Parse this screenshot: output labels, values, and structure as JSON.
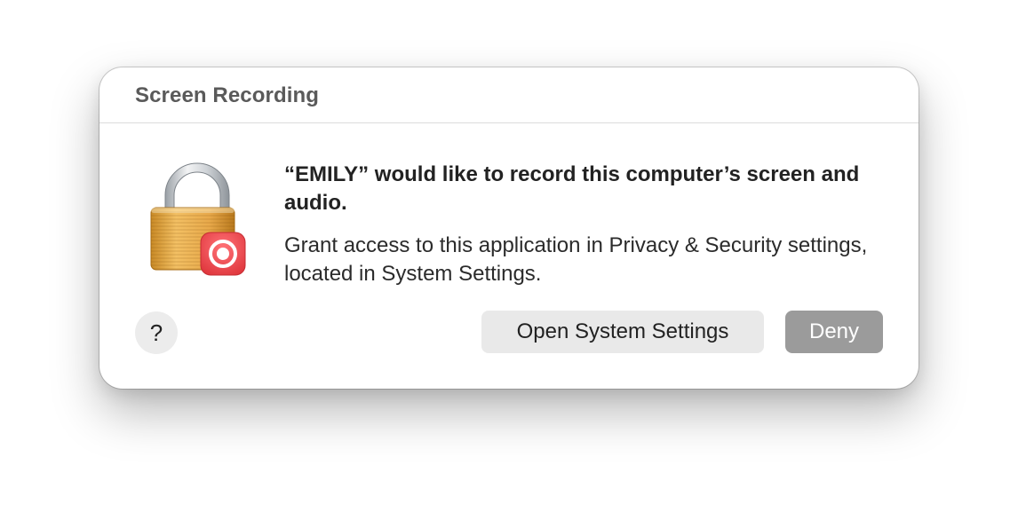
{
  "dialog": {
    "title": "Screen Recording",
    "headline": "“EMILY” would like to record this computer’s screen and audio.",
    "body": "Grant access to this application in Privacy & Security settings, located in System Settings.",
    "icon": "lock-with-record-badge-icon"
  },
  "buttons": {
    "help_label": "?",
    "open_settings_label": "Open System Settings",
    "deny_label": "Deny"
  },
  "colors": {
    "lock_gold": "#E6A23C",
    "lock_shackle": "#C9CDD2",
    "record_badge": "#E8464C",
    "deny_button": "#9B9B9B",
    "secondary_button": "#E9E9E9"
  }
}
